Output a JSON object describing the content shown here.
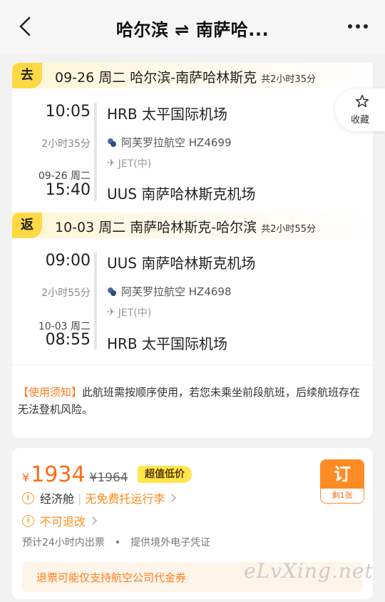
{
  "header": {
    "title": "哈尔滨 ⇌ 南萨哈..."
  },
  "favorite": {
    "label": "收藏"
  },
  "outbound": {
    "tag": "去",
    "route": "09-26 周二  哈尔滨-南萨哈林斯克",
    "total_duration": "共2小时35分",
    "dep_time": "10:05",
    "dep_airport": "HRB 太平国际机场",
    "duration": "2小时35分",
    "airline": "阿芙罗拉航空 HZ4699",
    "aircraft": "JET(中)",
    "arr_date": "09-26 周二",
    "arr_time": "15:40",
    "arr_airport": "UUS 南萨哈林斯克机场"
  },
  "inbound": {
    "tag": "返",
    "route": "10-03 周二  南萨哈林斯克-哈尔滨",
    "total_duration": "共2小时55分",
    "dep_time": "09:00",
    "dep_airport": "UUS 南萨哈林斯克机场",
    "duration": "2小时55分",
    "airline": "阿芙罗拉航空 HZ4698",
    "aircraft": "JET(中)",
    "arr_date": "10-03 周二",
    "arr_time": "08:55",
    "arr_airport": "HRB 太平国际机场"
  },
  "notice": {
    "label": "【使用须知】",
    "text": "此航班需按顺序使用，若您未乘坐前段航班，后续航班存在无法登机风险。"
  },
  "offer": {
    "currency": "¥",
    "price": "1934",
    "original_price": "¥1964",
    "badge": "超值低价",
    "cabin": "经济舱",
    "baggage": "无免费托运行李",
    "refund": "不可退改",
    "ticketing": "预计24小时内出票",
    "voucher_info": "提供境外电子凭证",
    "voucher_note": "退票可能仅支持航空公司代金券",
    "book_label": "订",
    "remaining": "剩1张"
  },
  "watermark": "eLvXing.net",
  "colors": {
    "accent": "#ff6a13",
    "tag_yellow": "#ffd845",
    "badge_yellow": "#ffe64a"
  }
}
